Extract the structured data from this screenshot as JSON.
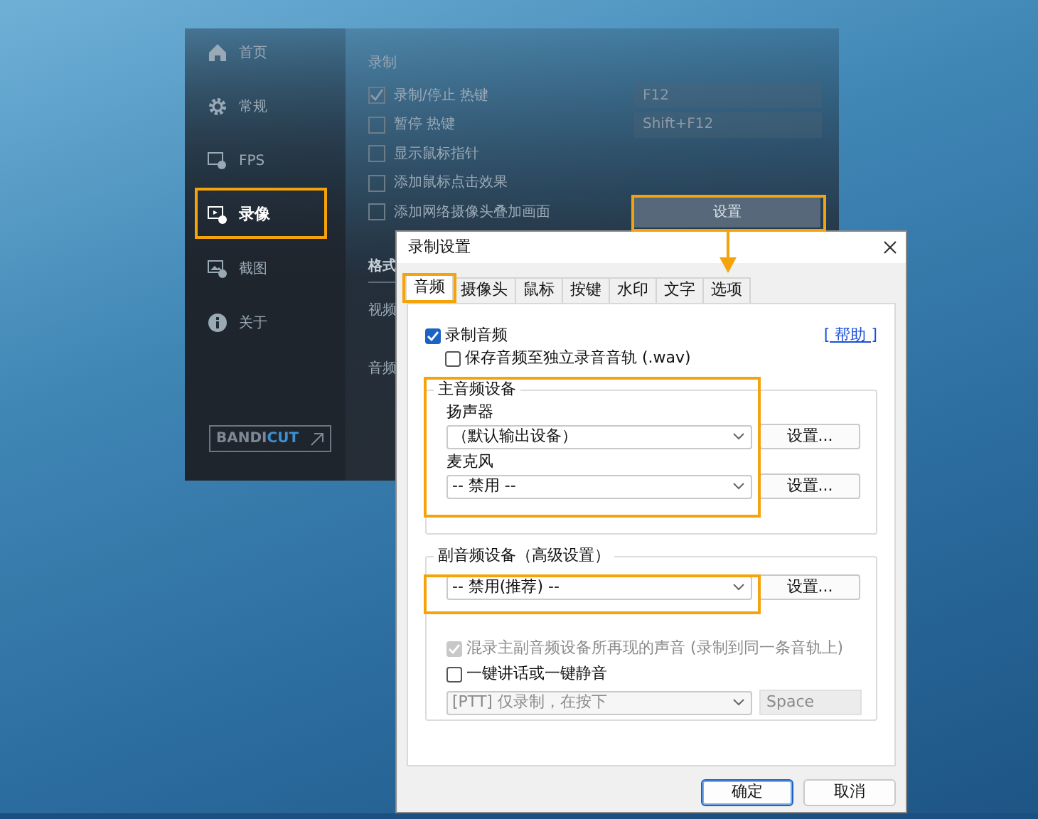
{
  "background_app": {
    "sidebar": {
      "items": [
        {
          "label": "首页",
          "selected": false
        },
        {
          "label": "常规",
          "selected": false
        },
        {
          "label": "FPS",
          "selected": false
        },
        {
          "label": "录像",
          "selected": true
        },
        {
          "label": "截图",
          "selected": false
        },
        {
          "label": "关于",
          "selected": false
        }
      ],
      "logo_button": [
        "BANDI",
        "CUT"
      ]
    },
    "section_title": "录制",
    "options": [
      {
        "label": "录制/停止 热键",
        "checked": true,
        "hotkey": "F12"
      },
      {
        "label": "暂停 热键",
        "checked": false,
        "hotkey": "Shift+F12"
      },
      {
        "label": "显示鼠标指针",
        "checked": false
      },
      {
        "label": "添加鼠标点击效果",
        "checked": false
      },
      {
        "label": "添加网络摄像头叠加画面",
        "checked": false,
        "button": "设置"
      }
    ],
    "format_tab": "格式",
    "format_labels": [
      "视频",
      "音频"
    ]
  },
  "dialog": {
    "title": "录制设置",
    "tabs": [
      {
        "label": "音频",
        "selected": true
      },
      {
        "label": "摄像头",
        "selected": false
      },
      {
        "label": "鼠标",
        "selected": false
      },
      {
        "label": "按键",
        "selected": false
      },
      {
        "label": "水印",
        "selected": false
      },
      {
        "label": "文字",
        "selected": false
      },
      {
        "label": "选项",
        "selected": false
      }
    ],
    "record_audio": {
      "label": "录制音频",
      "checked": true
    },
    "help_link": "[ 帮助 ]",
    "save_wav": {
      "label": "保存音频至独立录音音轨 (.wav)",
      "checked": false
    },
    "primary_group": {
      "title": "主音频设备",
      "devices": [
        {
          "label": "扬声器",
          "value": "（默认输出设备）",
          "button": "设置..."
        },
        {
          "label": "麦克风",
          "value": "-- 禁用 --",
          "button": "设置..."
        }
      ]
    },
    "secondary_group": {
      "title": "副音频设备（高级设置）",
      "value": "-- 禁用(推荐) --",
      "button": "设置...",
      "mix": {
        "label": "混录主副音频设备所再现的声音 (录制到同一条音轨上)",
        "checked": true,
        "disabled": true
      },
      "ptt": {
        "label": "一键讲话或一键静音",
        "checked": false,
        "disabled": false
      },
      "ptt_mode": {
        "value": "[PTT] 仅录制，在按下",
        "disabled": true
      },
      "ptt_key": {
        "value": "Space",
        "disabled": true
      }
    },
    "buttons": [
      {
        "label": "确定",
        "default": true
      },
      {
        "label": "取消",
        "default": false
      }
    ]
  }
}
